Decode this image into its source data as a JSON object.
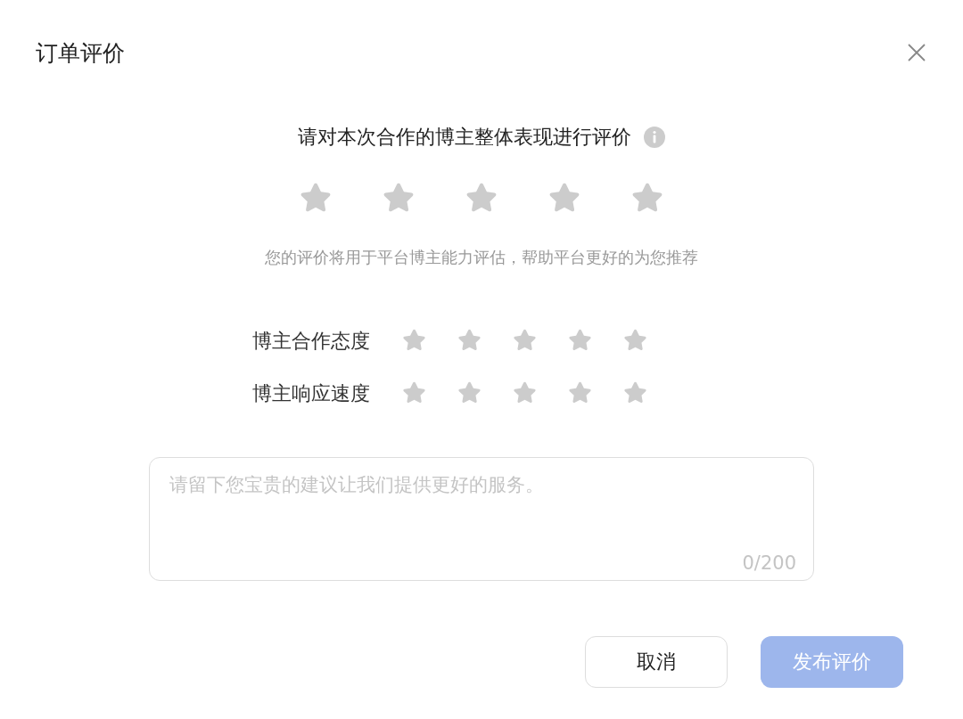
{
  "dialog": {
    "title": "订单评价"
  },
  "overall": {
    "heading": "请对本次合作的博主整体表现进行评价",
    "stars": 0,
    "hint": "您的评价将用于平台博主能力评估，帮助平台更好的为您推荐"
  },
  "criteria": [
    {
      "label": "博主合作态度",
      "stars": 0
    },
    {
      "label": "博主响应速度",
      "stars": 0
    }
  ],
  "comment": {
    "placeholder": "请留下您宝贵的建议让我们提供更好的服务。",
    "counter": "0/200"
  },
  "buttons": [
    {
      "label": "取消",
      "kind": "secondary",
      "disabled": false
    },
    {
      "label": "发布评价",
      "kind": "primary",
      "disabled": true
    }
  ]
}
